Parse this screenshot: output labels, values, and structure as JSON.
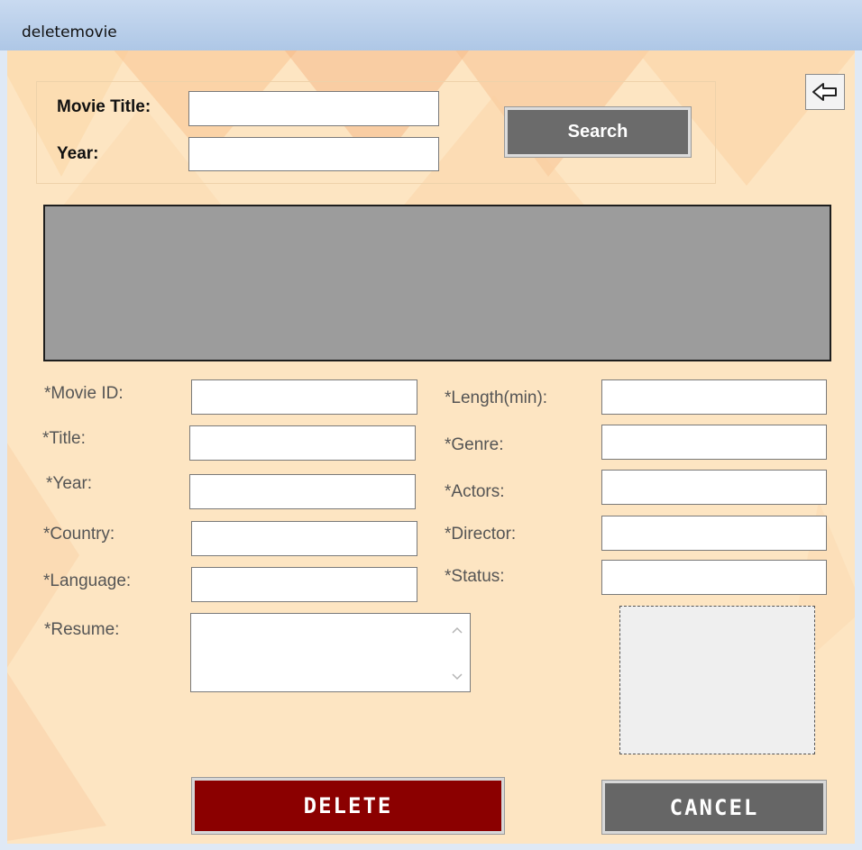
{
  "window": {
    "title": "deletemovie"
  },
  "colors": {
    "form_background": "#fde5c2",
    "grid_background": "#9c9c9c",
    "delete_button": "#8b0000",
    "gray_button": "#6b6b6b"
  },
  "search": {
    "movie_title_label": "Movie Title:",
    "movie_title_value": "",
    "year_label": "Year:",
    "year_value": "",
    "search_button": "Search"
  },
  "back_button": {
    "icon": "back-arrow-icon"
  },
  "results_grid": {
    "rows": []
  },
  "details": {
    "movie_id": {
      "label": "*Movie ID:",
      "value": ""
    },
    "title": {
      "label": "*Title:",
      "value": ""
    },
    "year": {
      "label": "*Year:",
      "value": ""
    },
    "country": {
      "label": "*Country:",
      "value": ""
    },
    "language": {
      "label": "*Language:",
      "value": ""
    },
    "resume": {
      "label": "*Resume:",
      "value": ""
    },
    "length": {
      "label": "*Length(min):",
      "value": ""
    },
    "genre": {
      "label": "*Genre:",
      "value": ""
    },
    "actors": {
      "label": "*Actors:",
      "value": ""
    },
    "director": {
      "label": "*Director:",
      "value": ""
    },
    "status": {
      "label": "*Status:",
      "value": ""
    }
  },
  "actions": {
    "delete_label": "DELETE",
    "cancel_label": "CANCEL"
  }
}
